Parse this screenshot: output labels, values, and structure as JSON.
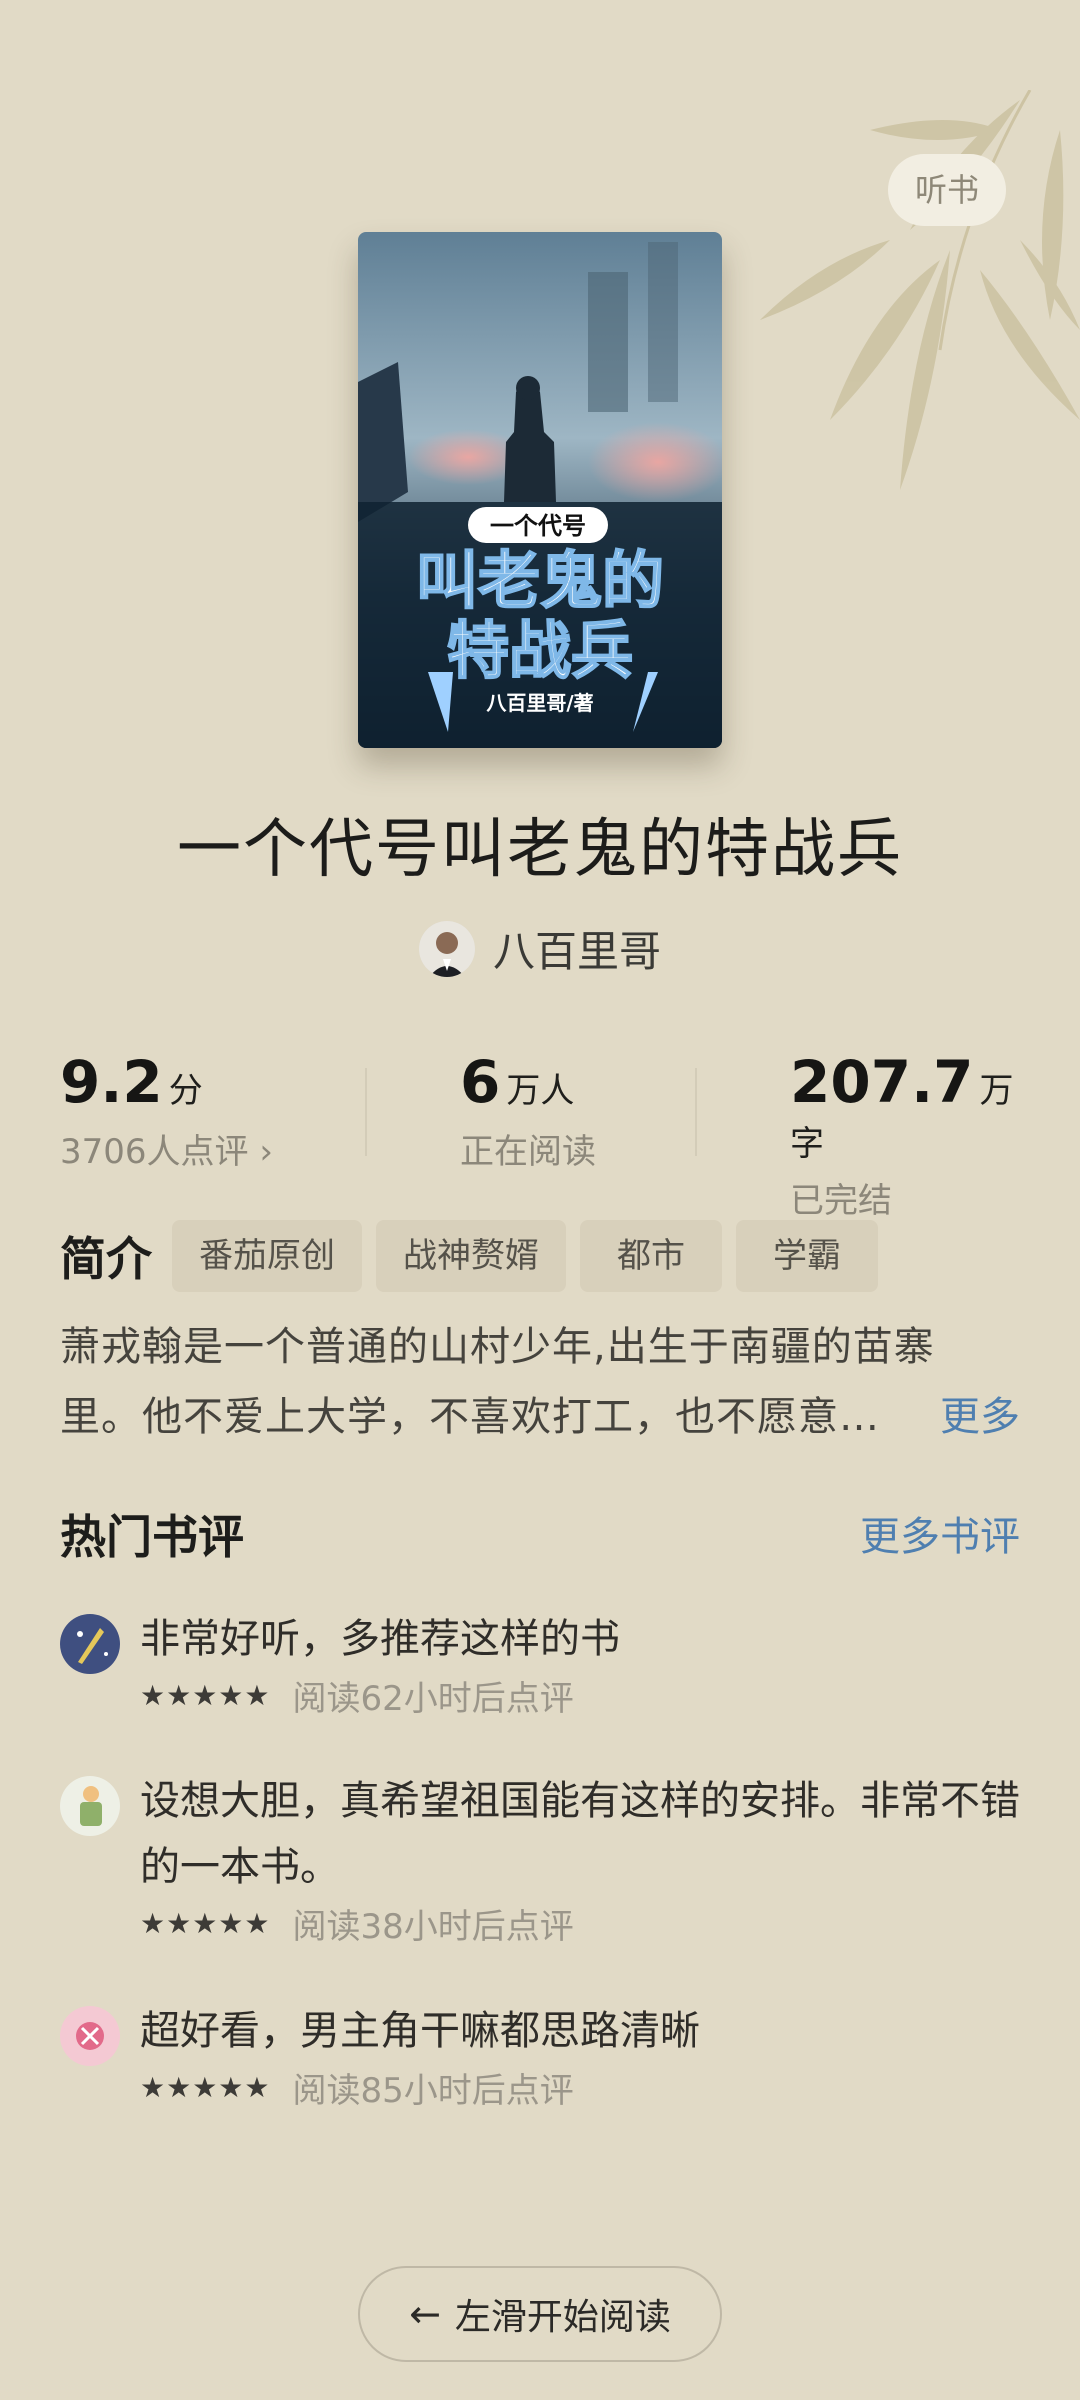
{
  "header": {
    "listen_label": "听书"
  },
  "book": {
    "title": "一个代号叫老鬼的特战兵",
    "cover": {
      "text_small": "一个代号",
      "text_main_1": "叫老鬼的",
      "text_main_2": "特战兵",
      "author_credit": "八百里哥/著"
    },
    "author": "八百里哥"
  },
  "stats": {
    "rating": {
      "value": "9.2",
      "unit": "分",
      "sub": "3706人点评 ›"
    },
    "readers": {
      "value": "6",
      "unit": "万人",
      "sub": "正在阅读"
    },
    "words": {
      "value": "207.7",
      "unit": "万字",
      "sub": "已完结"
    }
  },
  "intro": {
    "label": "简介",
    "tags": [
      "番茄原创",
      "战神赘婿",
      "都市",
      "学霸"
    ],
    "line1": "萧戎翰是一个普通的山村少年,出生于南疆的苗寨",
    "line2": "里。他不爱上大学，不喜欢打工，也不愿意…",
    "more": "更多"
  },
  "hot_reviews": {
    "title": "热门书评",
    "more": "更多书评",
    "items": [
      {
        "text": "非常好听，多推荐这样的书",
        "stars": "★★★★★",
        "meta": "阅读62小时后点评"
      },
      {
        "text": "设想大胆，真希望祖国能有这样的安排。非常不错的一本书。",
        "stars": "★★★★★",
        "meta": "阅读38小时后点评"
      },
      {
        "text": "超好看，男主角干嘛都思路清晰",
        "stars": "★★★★★",
        "meta": "阅读85小时后点评"
      }
    ]
  },
  "footer": {
    "start_label": "左滑开始阅读",
    "arrow": "←"
  },
  "colors": {
    "background": "#e1dac6",
    "link": "#4f7fb0"
  }
}
